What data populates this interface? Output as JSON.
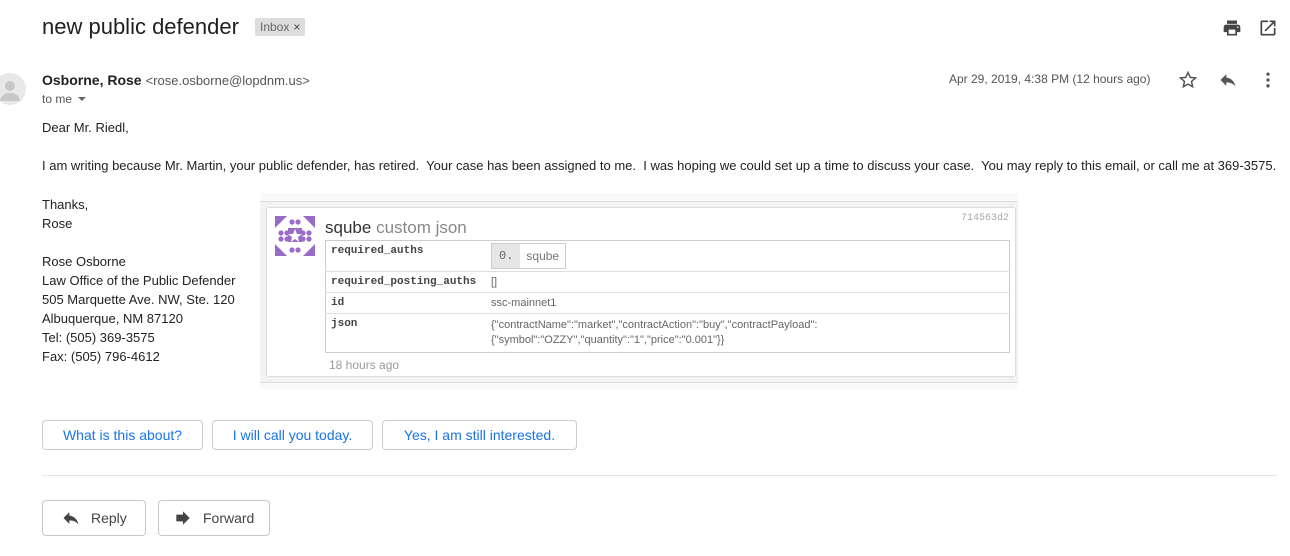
{
  "subject": "new public defender",
  "label_badge": "Inbox",
  "label_close": "×",
  "sender": {
    "name": "Osborne, Rose",
    "email": "<rose.osborne@lopdnm.us>",
    "to": "to me"
  },
  "date": "Apr 29, 2019, 4:38 PM (12 hours ago)",
  "body": {
    "greeting": "Dear Mr. Riedl,",
    "paragraph": "I am writing because Mr. Martin, your public defender, has retired.  Your case has been assigned to me.  I was hoping we could set up a time to discuss your case.  You may reply to this email, or call me at 369-3575."
  },
  "signature": [
    "Thanks,",
    "Rose",
    "",
    "Rose Osborne",
    "Law Office of the Public Defender",
    "505 Marquette Ave. NW, Ste. 120",
    "Albuquerque, NM 87120",
    "Tel: (505) 369-3575",
    "Fax: (505) 796-4612"
  ],
  "embedded_card": {
    "user": "sqube",
    "op_name": "custom json",
    "hash": "714563d2",
    "rows": [
      {
        "key": "required_auths",
        "index": "0.",
        "value": "sqube"
      },
      {
        "key": "required_posting_auths",
        "value": "[]"
      },
      {
        "key": "id",
        "value": "ssc-mainnet1"
      },
      {
        "key": "json",
        "value_line1": "{\"contractName\":\"market\",\"contractAction\":\"buy\",\"contractPayload\":",
        "value_line2": "{\"symbol\":\"OZZY\",\"quantity\":\"1\",\"price\":\"0.001\"}}"
      }
    ],
    "time": "18 hours ago"
  },
  "smart_replies": [
    "What is this about?",
    "I will call you today.",
    "Yes, I am still interested."
  ],
  "actions": {
    "reply": "Reply",
    "forward": "Forward"
  },
  "colors": {
    "accent": "#1a73e8",
    "identicon": "#9a6cc8"
  },
  "icons": [
    "print-icon",
    "open-new-window-icon",
    "star-icon",
    "reply-icon",
    "more-vert-icon",
    "chevron-down-icon",
    "forward-icon"
  ]
}
